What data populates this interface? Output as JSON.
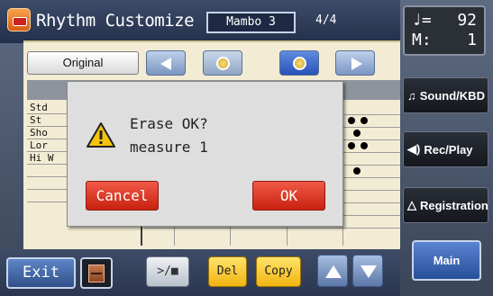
{
  "title_bar": {
    "app_title": "Rhythm Customize",
    "rhythm_name": "Mambo 3",
    "time_signature": "4/4"
  },
  "tempo": {
    "tempo_symbol": "♩=",
    "tempo_value": "92",
    "measure_label": "M:",
    "measure_value": "1"
  },
  "editor": {
    "original_label": "Original",
    "instruments": [
      "Std",
      "St",
      "Sho",
      "Lor",
      "Hi W",
      "",
      "",
      ""
    ]
  },
  "dialog": {
    "message": "Erase OK?",
    "detail": "measure 1",
    "cancel_label": "Cancel",
    "ok_label": "OK"
  },
  "bottom_bar": {
    "exit_label": "Exit",
    "play_stop_label": ">/■",
    "del_label": "Del",
    "copy_label": "Copy"
  },
  "side_panel": {
    "sound_kbd_label": "Sound/KBD",
    "rec_play_label": "Rec/Play",
    "registration_label": "Registration",
    "main_label": "Main"
  },
  "colors": {
    "accent_red": "#d9301d",
    "accent_yellow": "#f5c52a",
    "accent_blue": "#3c66c4",
    "panel_bg": "#f3ecd4"
  },
  "icons": [
    "app-drum-icon",
    "warning-icon",
    "zoom-out-icon",
    "zoom-in-icon",
    "store-icon",
    "music-note-icon",
    "speaker-icon",
    "registration-icon"
  ]
}
